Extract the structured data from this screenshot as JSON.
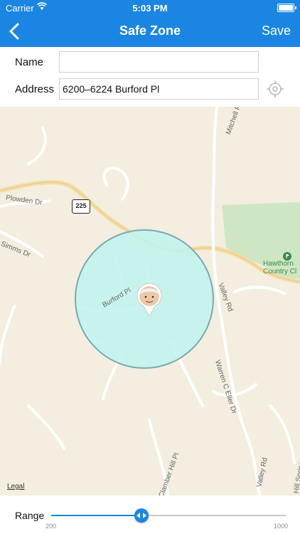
{
  "status_bar": {
    "carrier": "Carrier",
    "time": "5:03 PM",
    "wifi_icon": "wifi-icon",
    "battery_icon": "battery-icon"
  },
  "nav": {
    "title": "Safe Zone",
    "save_label": "Save",
    "back_icon": "chevron-left-icon",
    "background": "#1b85e4"
  },
  "form": {
    "name_label": "Name",
    "name_value": "",
    "address_label": "Address",
    "address_value": "6200–6224 Burford Pl",
    "locate_icon": "crosshair-icon"
  },
  "map": {
    "route_shield": "225",
    "streets": {
      "plowden": "Plowden Dr",
      "simms": "Simms Dr",
      "burford": "Burford Pl",
      "mitchell": "Mitchell Rd",
      "valley": "Valley Rd",
      "warren": "Warren C Eller Dr",
      "clamber": "Clamber Hill Pl",
      "valley2": "Valley Rd",
      "hill_spring": "Hill Spring"
    },
    "park_name_line1": "Hawthorn",
    "park_name_line2": "Country Cl",
    "legal": "Legal",
    "zone_fill": "#bff3ef",
    "zone_stroke": "#7aa8b4"
  },
  "range": {
    "label": "Range",
    "min": "200",
    "max": "1000",
    "value_fraction": 0.385,
    "accent": "#1b85e4"
  }
}
